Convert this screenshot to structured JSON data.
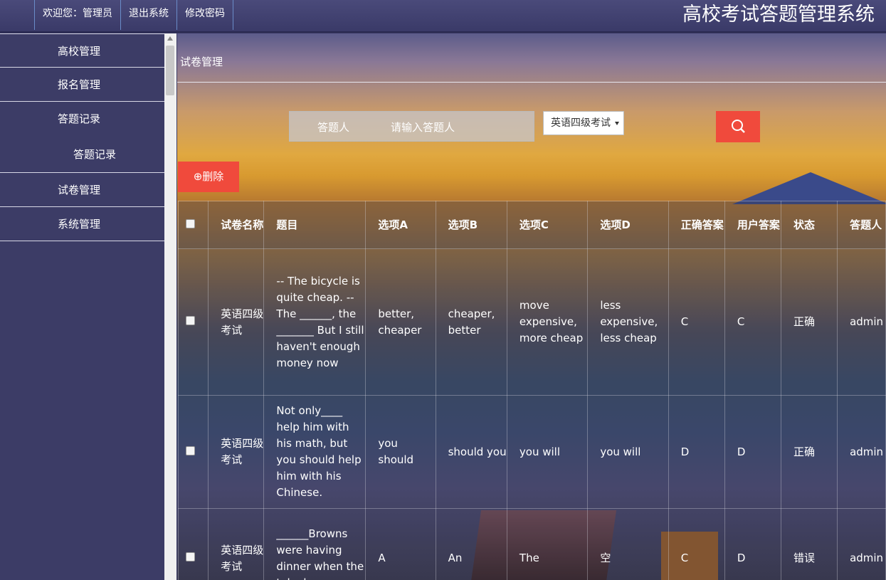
{
  "header": {
    "nav": [
      "欢迎您：管理员",
      "退出系统",
      "修改密码"
    ],
    "title": "高校考试答题管理系统"
  },
  "sidebar": {
    "items": [
      "高校管理",
      "报名管理",
      "答题记录",
      "答题记录",
      "试卷管理",
      "系统管理"
    ]
  },
  "main": {
    "breadcrumb": "试卷管理",
    "search": {
      "label": "答题人",
      "placeholder": "请输入答题人",
      "select_value": "英语四级考试"
    },
    "delete_label": "⊕删除",
    "table": {
      "headers": [
        "试卷名称",
        "题目",
        "选项A",
        "选项B",
        "选项C",
        "选项D",
        "正确答案",
        "用户答案",
        "状态",
        "答题人"
      ],
      "rows": [
        [
          "英语四级考试",
          "-- The bicycle is quite cheap. --The ______, the _______ But I still haven't enough money now",
          "better, cheaper",
          "cheaper, better",
          "move expensive, more cheap",
          "less expensive, less cheap",
          "C",
          "C",
          "正确",
          "admin"
        ],
        [
          "英语四级考试",
          "Not only____ help him with his math, but you should help him with his Chinese.",
          "you should",
          "should you",
          "you will",
          "you will",
          "D",
          "D",
          "正确",
          "admin"
        ],
        [
          "英语四级考试",
          "______Browns were having dinner when the telephone",
          "A",
          "An",
          "The",
          "空",
          "C",
          "D",
          "错误",
          "admin"
        ]
      ]
    }
  },
  "colors": {
    "accent": "#f04a3c",
    "sidebar": "#3c3c66"
  },
  "icons": [
    "search-icon",
    "plus-circle-icon",
    "checkbox"
  ]
}
